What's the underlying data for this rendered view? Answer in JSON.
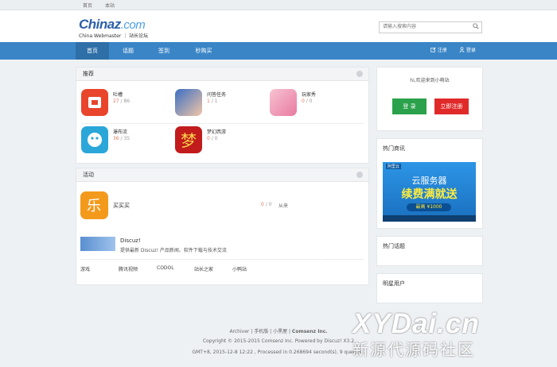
{
  "topbar": {
    "home": "首页",
    "this_site": "本站"
  },
  "logo": {
    "brand": "Chinaz",
    "domain": ".com",
    "tagline": "China Webmaster ｜ 站长论坛"
  },
  "search": {
    "placeholder": "请输入搜索内容"
  },
  "nav": {
    "items": [
      "首页",
      "话题",
      "签到",
      "秒购买"
    ],
    "register": "注册",
    "login": "登录"
  },
  "recommend": {
    "title": "推荐",
    "apps": [
      {
        "name": "吐槽",
        "count_hot": "27",
        "count_total": "86"
      },
      {
        "name": "问答任务",
        "count_hot": "1",
        "count_total": "1"
      },
      {
        "name": "玩家秀",
        "count_hot": "0",
        "count_total": "0"
      },
      {
        "name": "瀑布流",
        "count_hot": "36",
        "count_total": "35"
      },
      {
        "name": "梦幻西游",
        "count_hot": "0",
        "count_total": "0"
      }
    ]
  },
  "activity": {
    "title": "活动",
    "item_name": "买买买",
    "item_count_hot": "0",
    "item_count_total": "0",
    "item_from": "从来",
    "discuz_title": "Discuz!",
    "discuz_desc": "提供最新 Discuz! 产品新闻、软件下载与技术交流",
    "links": [
      "游戏",
      "腾讯视频",
      "CODOL",
      "站长之家",
      "小鸭站"
    ]
  },
  "sidebar": {
    "welcome": "hi,欢迎来到小萌站",
    "login_btn": "登 录",
    "register_btn": "立即注册",
    "hot_ads_title": "热门商讯",
    "ad_brand": "阿里云",
    "ad_line1": "云服务器",
    "ad_line2": "续费满就送",
    "ad_line3": "最高 ¥1000",
    "hot_topics_title": "热门话题",
    "star_users_title": "明星用户"
  },
  "footer": {
    "links": [
      "Archiver",
      "手机版",
      "小黑屋",
      "Comsenz Inc."
    ],
    "copyright": "Copyright © 2015-2015 Comsenz Inc. Powered by Discuz! X3.2",
    "gmt": "GMT+8, 2015-12-8 12:22 , Processed in 0.268694 second(s), 9 queries ."
  },
  "watermark": {
    "latin": "XYDai.cn",
    "chinese": "新源代源码社区"
  },
  "colors": {
    "nav": "#3a85c6",
    "login_btn": "#2aa14a",
    "register_btn": "#e02a2a"
  }
}
